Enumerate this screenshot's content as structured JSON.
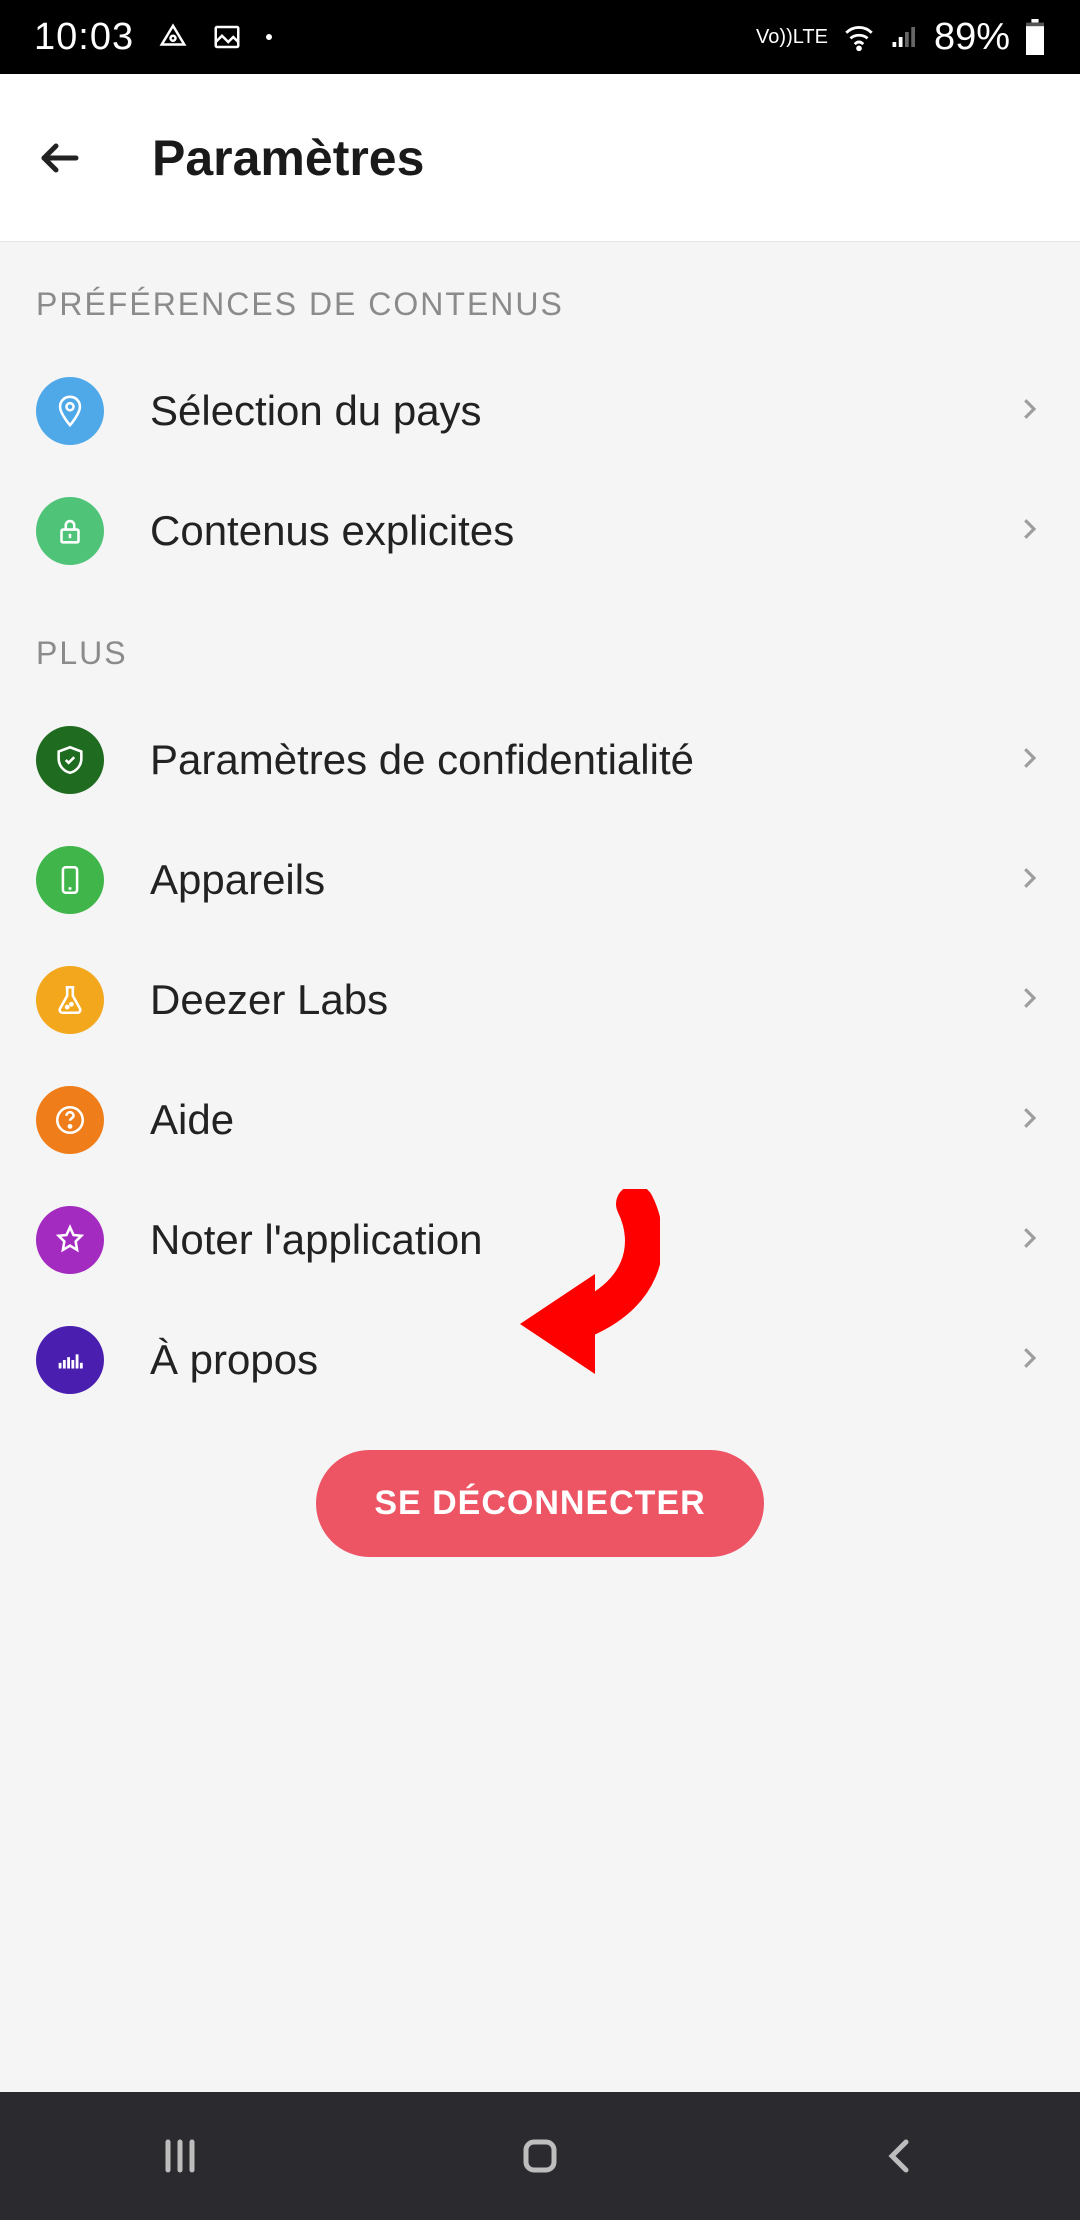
{
  "status": {
    "time": "10:03",
    "volte": "Vo))",
    "lte": "LTE",
    "battery_pct": "89%"
  },
  "header": {
    "title": "Paramètres"
  },
  "sections": {
    "prefs_title": "PRÉFÉRENCES DE CONTENUS",
    "plus_title": "PLUS"
  },
  "rows": {
    "country": "Sélection du pays",
    "explicit": "Contenus explicites",
    "privacy": "Paramètres de confidentialité",
    "devices": "Appareils",
    "labs": "Deezer Labs",
    "help": "Aide",
    "rate": "Noter l'application",
    "about": "À propos"
  },
  "logout": "SE DÉCONNECTER"
}
